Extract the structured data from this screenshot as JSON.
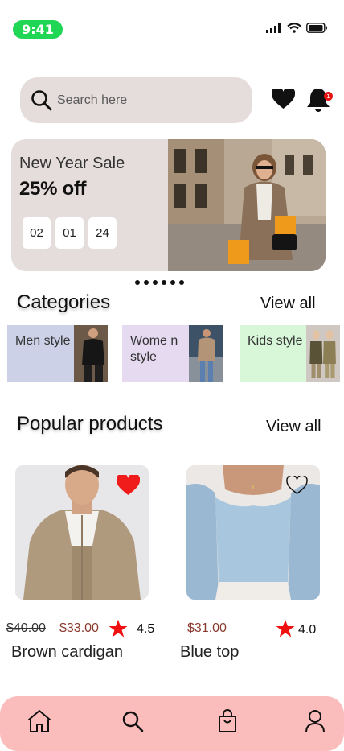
{
  "colors": {
    "green": "#1fd655",
    "panel": "#e5dcdc",
    "red": "#e81414",
    "brown": "#8b3a2e",
    "nav": "#fbbcbc",
    "men": "#cdd1e8",
    "women": "#e5daf0",
    "kids": "#d8f7d8"
  },
  "status": {
    "time": "9:41",
    "icons": [
      "signal-icon",
      "wifi-icon",
      "battery-icon"
    ]
  },
  "search": {
    "placeholder": "Search here"
  },
  "header": {
    "notification_count": "1"
  },
  "banner": {
    "title": "New Year Sale",
    "discount": "25% off",
    "countdown": [
      "02",
      "01",
      "24"
    ],
    "page_dots": 6
  },
  "categories": {
    "title": "Categories",
    "view_all": "View all",
    "items": [
      {
        "label": "Men style",
        "color": "men"
      },
      {
        "label": "Wome n style",
        "color": "women"
      },
      {
        "label": "Kids style",
        "color": "kids"
      }
    ]
  },
  "popular": {
    "title": "Popular products",
    "view_all": "View all",
    "items": [
      {
        "name": "Brown cardigan",
        "old_price": "$40.00",
        "price": "$33.00",
        "rating": "4.5",
        "favorite": true
      },
      {
        "name": "Blue top",
        "old_price": "",
        "price": "$31.00",
        "rating": "4.0",
        "favorite": false
      }
    ]
  },
  "nav": {
    "items": [
      "home-icon",
      "search-icon",
      "bag-icon",
      "profile-icon"
    ]
  }
}
